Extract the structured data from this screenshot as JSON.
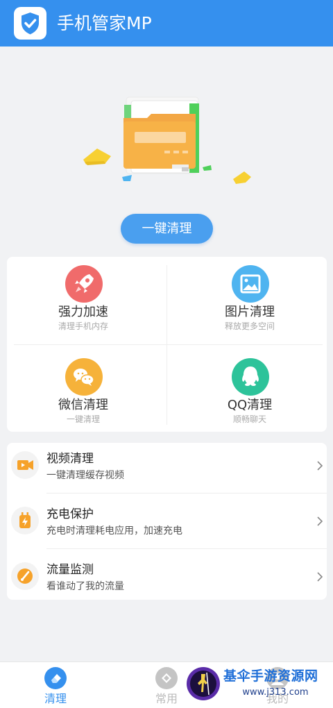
{
  "header": {
    "title": "手机管家MP",
    "logo_icon": "shield-check-icon"
  },
  "hero": {
    "illustration": "folder-illustration",
    "clean_button": "一键清理"
  },
  "grid": [
    {
      "title": "强力加速",
      "subtitle": "清理手机内存",
      "icon": "rocket-icon",
      "color": "#f06b6b"
    },
    {
      "title": "图片清理",
      "subtitle": "释放更多空间",
      "icon": "image-icon",
      "color": "#4fb4f0"
    },
    {
      "title": "微信清理",
      "subtitle": "一键清理",
      "icon": "wechat-icon",
      "color": "#f6b23a"
    },
    {
      "title": "QQ清理",
      "subtitle": "顺畅聊天",
      "icon": "qq-icon",
      "color": "#2dc39a"
    }
  ],
  "list": [
    {
      "title": "视频清理",
      "subtitle": "一键清理缓存视频",
      "icon": "video-icon"
    },
    {
      "title": "充电保护",
      "subtitle": "充电时清理耗电应用，加速充电",
      "icon": "charging-icon"
    },
    {
      "title": "流量监测",
      "subtitle": "看谁动了我的流量",
      "icon": "gauge-icon"
    }
  ],
  "tabs": [
    {
      "label": "清理",
      "icon": "eraser-icon",
      "active": true
    },
    {
      "label": "常用",
      "icon": "diamond-icon",
      "active": false
    },
    {
      "label": "我的",
      "icon": "user-icon",
      "active": false
    }
  ],
  "watermark": {
    "text": "基伞手游资源网",
    "url": "www.j313.com"
  },
  "colors": {
    "primary": "#3590ee",
    "accent_orange": "#f6a22a",
    "active_tab": "#3590ee",
    "inactive_tab": "#bbbbbb"
  }
}
